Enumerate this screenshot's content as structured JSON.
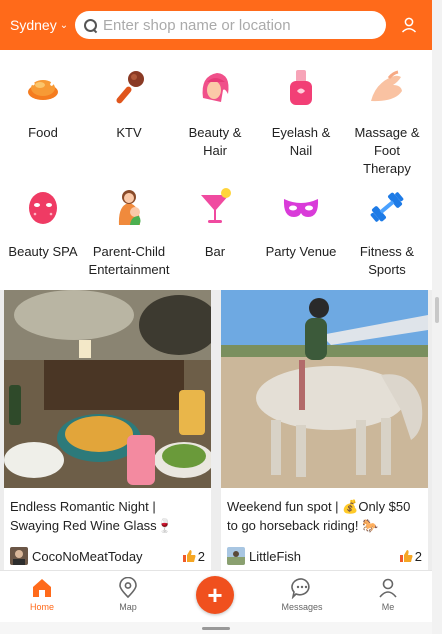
{
  "header": {
    "city": "Sydney",
    "search_placeholder": "Enter shop name or location"
  },
  "categories": [
    {
      "label": "Food",
      "icon": "roast-chicken-icon"
    },
    {
      "label": "KTV",
      "icon": "microphone-icon"
    },
    {
      "label": "Beauty &\nHair",
      "icon": "hair-salon-icon"
    },
    {
      "label": "Eyelash &\nNail",
      "icon": "nail-polish-icon"
    },
    {
      "label": "Massage &\nFoot\nTherapy",
      "icon": "massage-hand-icon"
    },
    {
      "label": "Beauty SPA",
      "icon": "face-mask-icon"
    },
    {
      "label": "Parent-Child\nEntertainment",
      "icon": "mother-child-icon"
    },
    {
      "label": "Bar",
      "icon": "cocktail-icon"
    },
    {
      "label": "Party Venue",
      "icon": "party-mask-icon"
    },
    {
      "label": "Fitness &\nSports",
      "icon": "dumbbell-icon"
    }
  ],
  "feed": [
    {
      "title": "Endless Romantic Night |\nSwaying Red Wine Glass🍷Among",
      "user": "CocoNoMeatToday",
      "likes": "2"
    },
    {
      "title": "Weekend fun spot | 💰Only $50\nto go horseback riding! 🐎",
      "user": "LittleFish",
      "likes": "2"
    }
  ],
  "nav": {
    "home": "Home",
    "map": "Map",
    "messages": "Messages",
    "me": "Me"
  },
  "colors": {
    "brand": "#ff6a1a",
    "fab": "#f0501e"
  }
}
